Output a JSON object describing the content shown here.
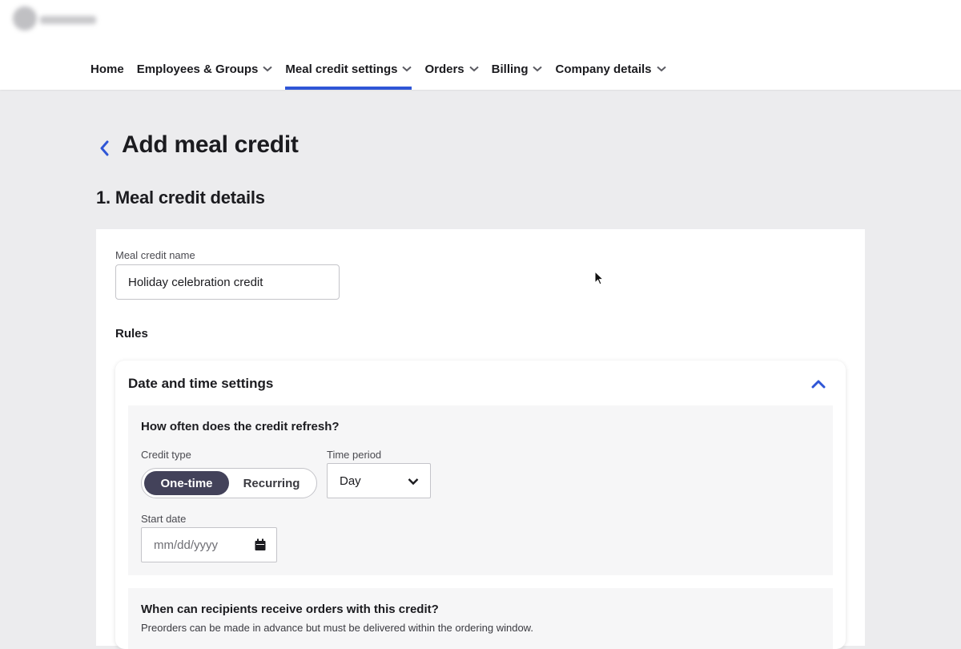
{
  "nav": {
    "items": [
      {
        "label": "Home",
        "has_dropdown": false,
        "active": false
      },
      {
        "label": "Employees & Groups",
        "has_dropdown": true,
        "active": false
      },
      {
        "label": "Meal credit settings",
        "has_dropdown": true,
        "active": true
      },
      {
        "label": "Orders",
        "has_dropdown": true,
        "active": false
      },
      {
        "label": "Billing",
        "has_dropdown": true,
        "active": false
      },
      {
        "label": "Company details",
        "has_dropdown": true,
        "active": false
      }
    ]
  },
  "page": {
    "title": "Add meal credit",
    "section_title": "1. Meal credit details"
  },
  "form": {
    "name_label": "Meal credit name",
    "name_value": "Holiday celebration credit",
    "rules_label": "Rules"
  },
  "date_time": {
    "title": "Date and time settings",
    "refresh_question": "How often does the credit refresh?",
    "credit_type_label": "Credit type",
    "credit_type_options": [
      "One-time",
      "Recurring"
    ],
    "credit_type_selected": "One-time",
    "time_period_label": "Time period",
    "time_period_value": "Day",
    "start_date_label": "Start date",
    "start_date_placeholder": "mm/dd/yyyy",
    "window_question": "When can recipients receive orders with this credit?",
    "window_note": "Preorders can be made in advance but must be delivered within the ordering window."
  },
  "colors": {
    "accent": "#2f56d6",
    "segment_selected": "#43425a",
    "background": "#ececee"
  }
}
